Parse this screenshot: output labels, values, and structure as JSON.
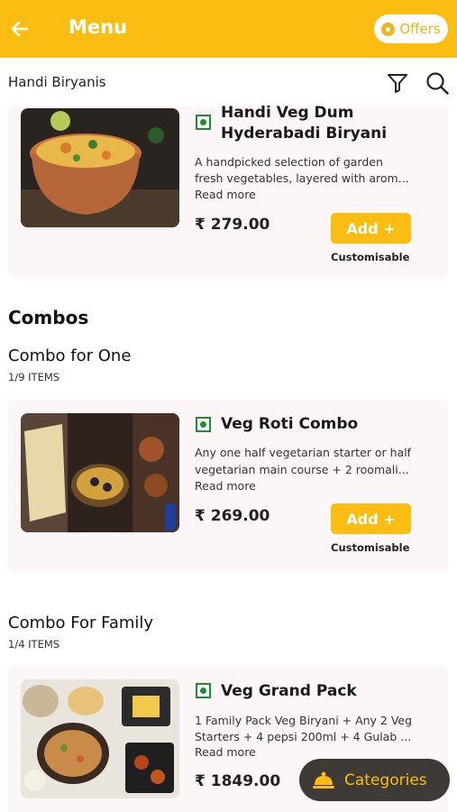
{
  "topbar": {
    "title": "Menu",
    "offers_label": "Offers"
  },
  "subheader": {
    "title": "Handi Biryanis"
  },
  "items": [
    {
      "name_line1": "Handi Veg Dum",
      "name_line2": "Hyderabadi Biryani",
      "desc_line1": "A handpicked selection of garden",
      "desc_line2": "fresh vegetables, layered with arom...",
      "read_more": "Read more",
      "price": "₹ 279.00",
      "add_label": "Add +",
      "customisable": "Customisable"
    },
    {
      "name_line1": "Veg Roti Combo",
      "desc_line1": "Any one half vegetarian starter or half",
      "desc_line2": "vegetarian main course +  2 roomali...",
      "read_more": "Read more",
      "price": "₹ 269.00",
      "add_label": "Add +",
      "customisable": "Customisable"
    },
    {
      "name_line1": "Veg Grand Pack",
      "desc_line1": "1 Family Pack Veg Biryani + Any 2 Veg",
      "desc_line2": "Starters  + 4 pepsi 200ml  + 4 Gulab ...",
      "read_more": "Read more",
      "price": "₹ 1849.00"
    }
  ],
  "sections": {
    "combos": "Combos",
    "combo_one": {
      "title": "Combo for One",
      "count": "1/9 ITEMS"
    },
    "combo_family": {
      "title": "Combo For Family",
      "count": "1/4 ITEMS"
    }
  },
  "categories_label": "Categories",
  "colors": {
    "accent": "#fbbd11",
    "veg_green": "#1c8f32",
    "card_bg": "#fdf6f6",
    "dark_button": "#3e3a36"
  }
}
